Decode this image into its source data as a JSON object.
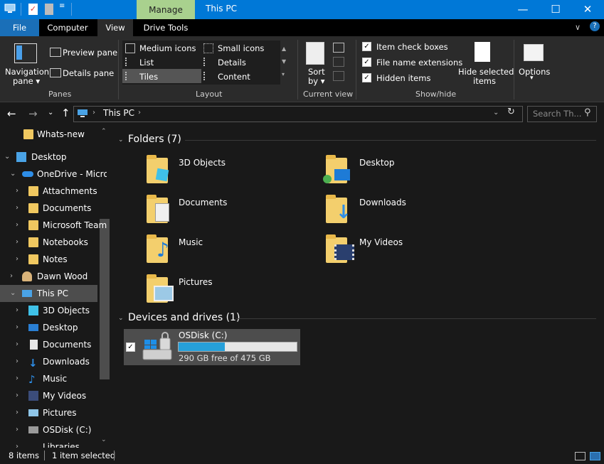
{
  "title_bar": {
    "manage_label": "Manage",
    "window_title": "This PC",
    "minimize": "—",
    "maximize": "☐",
    "close": "✕"
  },
  "tabs": {
    "file": "File",
    "computer": "Computer",
    "view": "View",
    "drive_tools": "Drive Tools"
  },
  "ribbon": {
    "panes": {
      "navigation_pane": "Navigation",
      "navigation_pane2": "pane ▾",
      "preview_pane": "Preview pane",
      "details_pane": "Details pane",
      "group": "Panes"
    },
    "layout": {
      "medium_icons": "Medium icons",
      "small_icons": "Small icons",
      "list": "List",
      "details": "Details",
      "tiles": "Tiles",
      "content": "Content",
      "group": "Layout"
    },
    "current_view": {
      "sort_by": "Sort",
      "sort_by2": "by ▾",
      "group": "Current view"
    },
    "show_hide": {
      "item_check_boxes": "Item check boxes",
      "file_name_extensions": "File name extensions",
      "hidden_items": "Hidden items",
      "hide_selected": "Hide selected",
      "hide_selected2": "items",
      "group": "Show/hide"
    },
    "options": {
      "label": "Options",
      "label2": "▾"
    }
  },
  "address": {
    "path": "This PC",
    "search_placeholder": "Search Th..."
  },
  "nav": [
    {
      "label": "Whats-new"
    },
    {
      "label": "Desktop"
    },
    {
      "label": "OneDrive - Micro"
    },
    {
      "label": "Attachments"
    },
    {
      "label": "Documents"
    },
    {
      "label": "Microsoft Team"
    },
    {
      "label": "Notebooks"
    },
    {
      "label": "Notes"
    },
    {
      "label": "Dawn Wood"
    },
    {
      "label": "This PC"
    },
    {
      "label": "3D Objects"
    },
    {
      "label": "Desktop"
    },
    {
      "label": "Documents"
    },
    {
      "label": "Downloads"
    },
    {
      "label": "Music"
    },
    {
      "label": "My Videos"
    },
    {
      "label": "Pictures"
    },
    {
      "label": "OSDisk (C:)"
    },
    {
      "label": "Libraries"
    }
  ],
  "content": {
    "folders_header": "Folders (7)",
    "folders": [
      "3D Objects",
      "Desktop",
      "Documents",
      "Downloads",
      "Music",
      "My Videos",
      "Pictures"
    ],
    "drives_header": "Devices and drives (1)",
    "drive": {
      "name": "OSDisk (C:)",
      "free_text": "290 GB free of 475 GB",
      "used_fraction": 0.39
    }
  },
  "status": {
    "items": "8 items",
    "selected": "1 item selected"
  },
  "colors": {
    "accent": "#0078d7",
    "manage_tab": "#a9d18e",
    "drive_bar": "#26a0da"
  }
}
